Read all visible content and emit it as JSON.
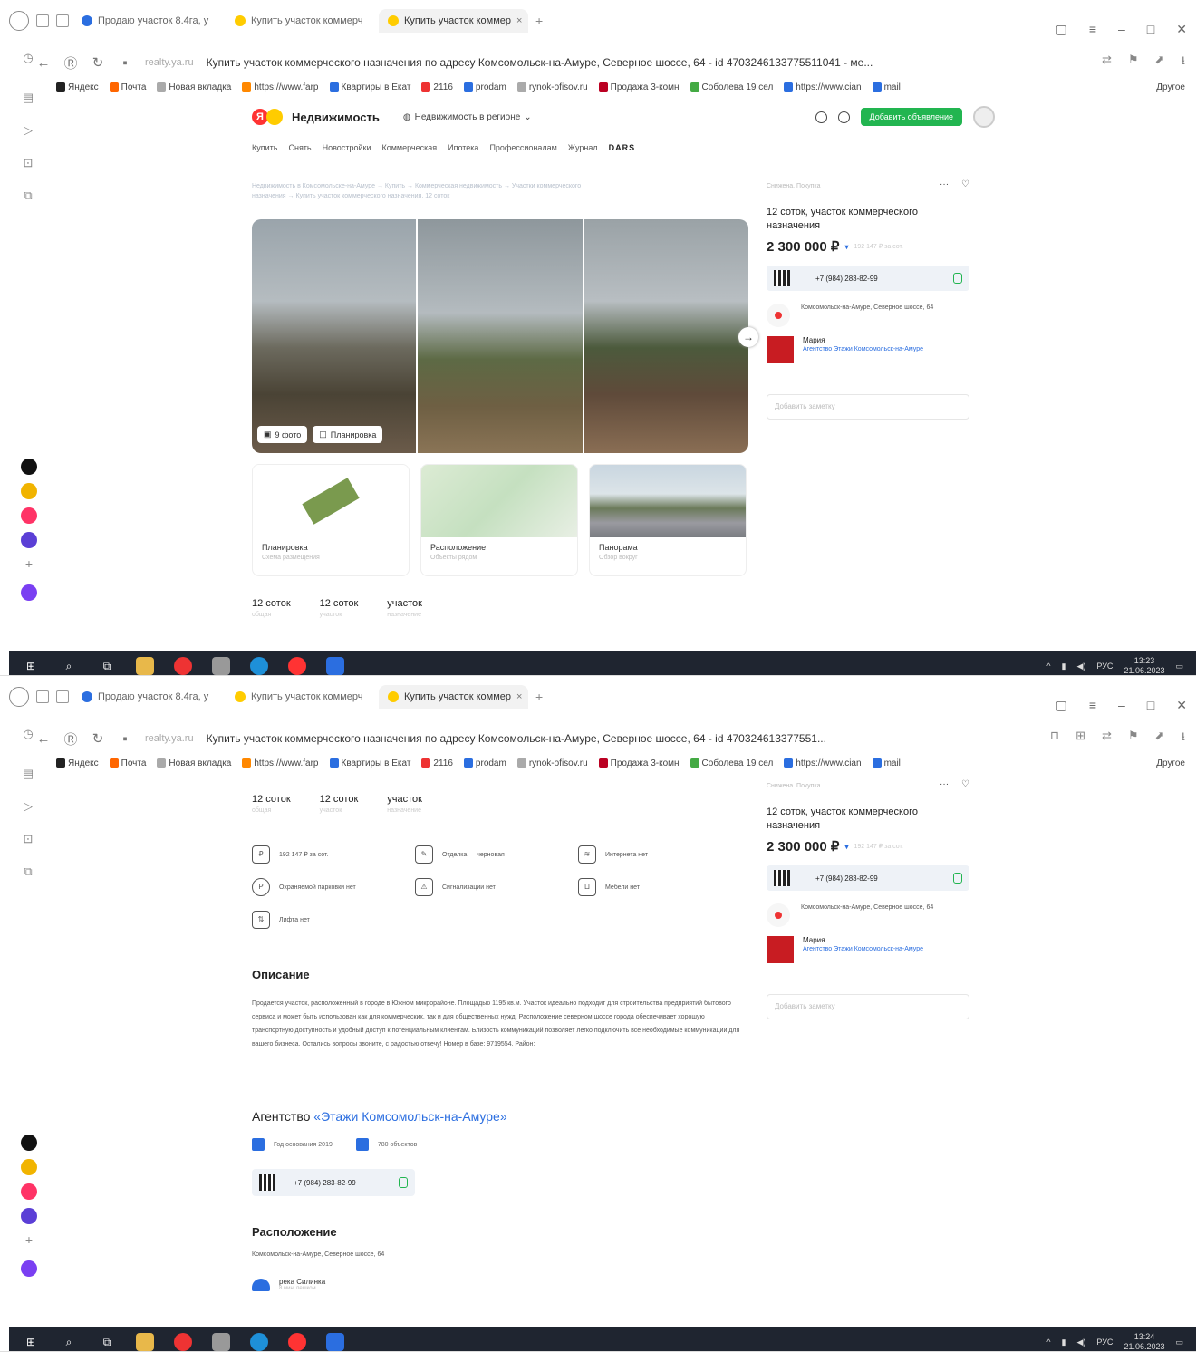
{
  "browser": {
    "tabs": [
      {
        "label": "Продаю участок 8.4га, у",
        "color": "#2b6ee0"
      },
      {
        "label": "Купить участок коммерч",
        "color": "#fc0"
      },
      {
        "label": "Купить участок коммер",
        "color": "#fc0"
      }
    ],
    "close_glyph": "×",
    "new_tab_glyph": "+",
    "domain": "realty.ya.ru",
    "page_title_1": "Купить участок коммерческого назначения по адресу Комсомольск-на-Амуре, Северное шоссе, 64 - id 4703246133775511041 - ме...",
    "page_title_2": "Купить участок коммерческого назначения по адресу Комсомольск-на-Амуре, Северное шоссе, 64 - id 470324613377551...",
    "bookmarks": [
      {
        "label": "Яндекс",
        "color": "#222"
      },
      {
        "label": "Почта",
        "color": "#f60"
      },
      {
        "label": "Новая вкладка",
        "color": "#aaa"
      },
      {
        "label": "https://www.farp",
        "color": "#f80"
      },
      {
        "label": "Квартиры в Екат",
        "color": "#2b6ee0"
      },
      {
        "label": "2116",
        "color": "#e33"
      },
      {
        "label": "prodam",
        "color": "#2b6ee0"
      },
      {
        "label": "rynok-ofisov.ru",
        "color": "#aaa"
      },
      {
        "label": "Продажа 3-комн",
        "color": "#b02"
      },
      {
        "label": "Соболева 19 сел",
        "color": "#4a4"
      },
      {
        "label": "https://www.cian",
        "color": "#2b6ee0"
      },
      {
        "label": "mail",
        "color": "#2b6ee0"
      }
    ],
    "other_bookmarks": "Другое"
  },
  "site": {
    "logo_letter": "Я",
    "logo_text": "Недвижимость",
    "region": "Недвижимость в регионе",
    "add_button": "Добавить объявление",
    "nav": [
      "Купить",
      "Снять",
      "Новостройки",
      "Коммерческая",
      "Ипотека",
      "Профессионалам",
      "Журнал"
    ],
    "nav_brand": "DARS",
    "breadcrumb": "Недвижимость в Комсомольске-на-Амуре → Купить → Коммерческая недвижимость → Участки коммерческого назначения → Купить участок коммерческого назначения, 12 соток"
  },
  "gallery": {
    "photos_button": "9 фото",
    "plan_button": "Планировка",
    "next_glyph": "→"
  },
  "cards": [
    {
      "title": "Планировка",
      "sub": "Схема размещения"
    },
    {
      "title": "Расположение",
      "sub": "Объекты рядом"
    },
    {
      "title": "Панорама",
      "sub": "Обзор вокруг"
    }
  ],
  "facts": [
    {
      "value": "12 соток",
      "label": "общая"
    },
    {
      "value": "12 соток",
      "label": "участок"
    },
    {
      "value": "участок",
      "label": "назначение"
    }
  ],
  "sidebar": {
    "crumb": "Снижена. Покупка",
    "more": "···",
    "title": "12 соток, участок коммерческого назначения",
    "price": "2 300 000 ₽",
    "price_arrow": "▾",
    "price_per": "192 147 ₽ за сот.",
    "phone": "+7 (984) 283-82-99",
    "address": "Комсомольск-на-Амуре, Северное шоссе, 64",
    "agent_name": "Мария",
    "agency": "Агентство Этажи Комсомольск-на-Амуре",
    "note_placeholder": "Добавить заметку"
  },
  "features": [
    {
      "icon": "price-per-area-icon",
      "text": "192 147 ₽ за сот."
    },
    {
      "icon": "finishing-icon",
      "text": "Отделка — черновая"
    },
    {
      "icon": "wifi-icon",
      "text": "Интернета нет"
    },
    {
      "icon": "parking-icon",
      "text": "Охраняемой парковки нет"
    },
    {
      "icon": "alarm-icon",
      "text": "Сигнализации нет"
    },
    {
      "icon": "furniture-icon",
      "text": "Мебели нет"
    },
    {
      "icon": "elevator-icon",
      "text": "Лифта нет"
    }
  ],
  "description": {
    "title": "Описание",
    "text": "Продается участок, расположенный в городе в Южном микрорайоне. Площадью 1195 кв.м. Участок идеально подходит для строительства предприятий бытового сервиса и может быть использован как для коммерческих, так и для общественных нужд. Расположение северном шоссе города обеспечивает хорошую транспортную доступность и удобный доступ к потенциальным клиентам. Близость коммуникаций позволяет легко подключить все необходимые коммуникации для вашего бизнеса. Остались вопросы звоните, с радостью отвечу! Номер в базе: 9719554. Район:"
  },
  "agency": {
    "title_prefix": "Агентство ",
    "title_link": "«Этажи Комсомольск-на-Амуре»",
    "founded": "Год основания 2019",
    "objects": "780 объектов",
    "phone": "+7 (984) 283-82-99"
  },
  "location": {
    "title": "Расположение",
    "address": "Комсомольск-на-Амуре, Северное шоссе, 64",
    "poi": "река Силинка",
    "poi_sub": "8 мин. пешком"
  },
  "taskbar": {
    "lang": "РУС",
    "time_1": "13:23",
    "time_2": "13:24",
    "date": "21.06.2023"
  },
  "colors": {
    "accent_green": "#22b550",
    "link_blue": "#2b6ee0",
    "taskbar": "#1f2530"
  }
}
